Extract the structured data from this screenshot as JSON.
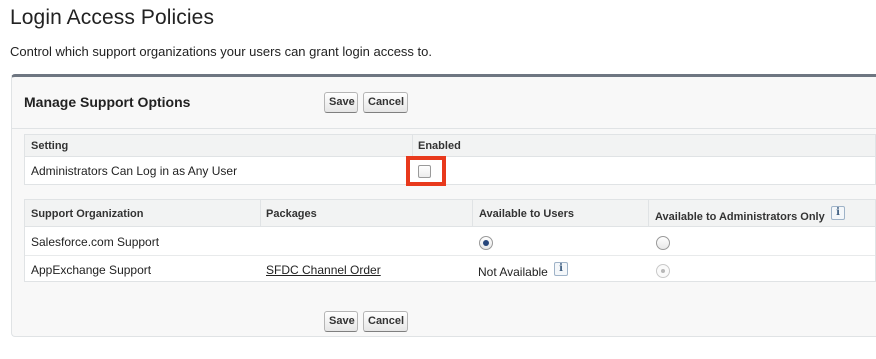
{
  "page": {
    "title": "Login Access Policies",
    "description": "Control which support organizations your users can grant login access to."
  },
  "panel": {
    "title": "Manage Support Options",
    "save_label": "Save",
    "cancel_label": "Cancel"
  },
  "settings_table": {
    "headers": {
      "setting": "Setting",
      "enabled": "Enabled"
    },
    "rows": [
      {
        "setting": "Administrators Can Log in as Any User",
        "enabled": false
      }
    ]
  },
  "support_table": {
    "headers": {
      "org": "Support Organization",
      "packages": "Packages",
      "users": "Available to Users",
      "admins": "Available to Administrators Only"
    },
    "rows": [
      {
        "org": "Salesforce.com Support",
        "package": "",
        "users_selected": true,
        "admins_selected": false
      },
      {
        "org": "AppExchange Support",
        "package": "SFDC Channel Order",
        "users_text": "Not Available",
        "admins_selected": true,
        "admins_disabled": true
      }
    ]
  },
  "icons": {
    "info": "info-icon",
    "info_glyph": "i"
  },
  "colors": {
    "highlight": "#e8391c",
    "panel_border": "#6e7681",
    "radio_selected": "#27467b"
  }
}
